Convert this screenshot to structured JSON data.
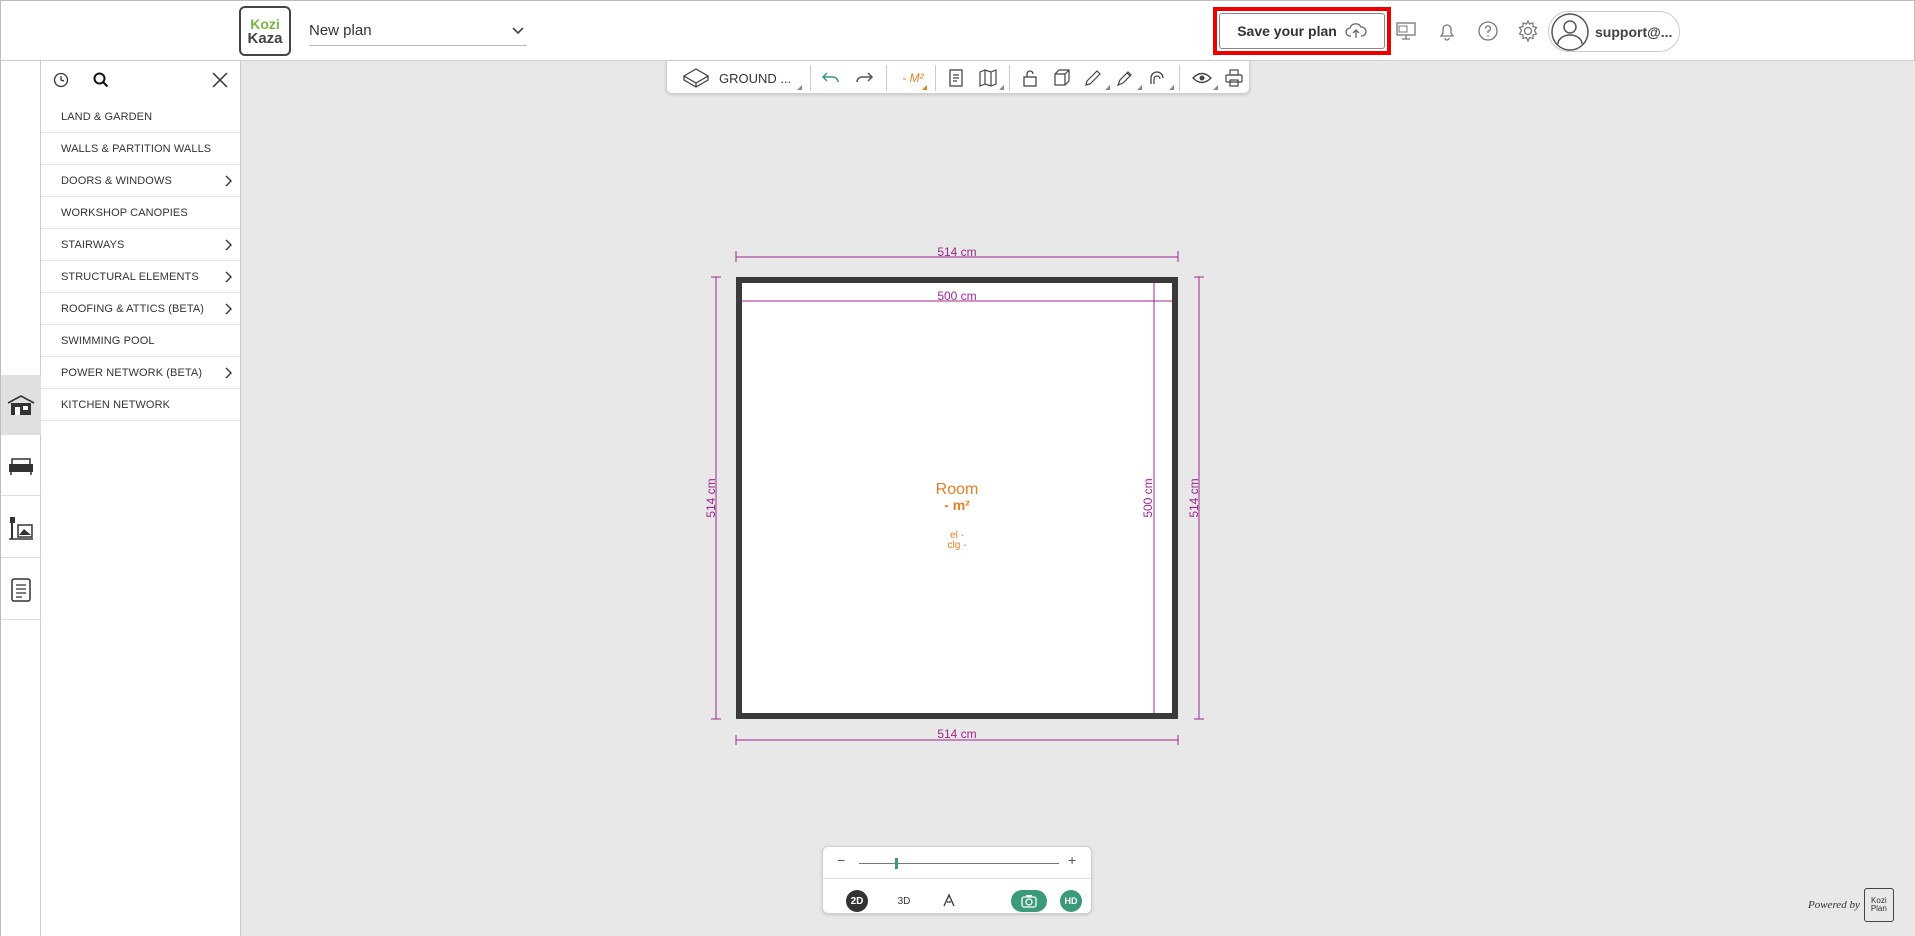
{
  "logo": {
    "line1": "Kozi",
    "line2": "Kaza"
  },
  "plan": {
    "name": "New plan"
  },
  "save": {
    "label": "Save your plan"
  },
  "user": {
    "name": "support@..."
  },
  "categories": [
    {
      "label": "LAND & GARDEN",
      "has_submenu": false
    },
    {
      "label": "WALLS & PARTITION WALLS",
      "has_submenu": false
    },
    {
      "label": "DOORS & WINDOWS",
      "has_submenu": true
    },
    {
      "label": "WORKSHOP CANOPIES",
      "has_submenu": false
    },
    {
      "label": "STAIRWAYS",
      "has_submenu": true
    },
    {
      "label": "STRUCTURAL ELEMENTS",
      "has_submenu": true
    },
    {
      "label": "ROOFING & ATTICS (BETA)",
      "has_submenu": true
    },
    {
      "label": "SWIMMING POOL",
      "has_submenu": false
    },
    {
      "label": "POWER NETWORK (BETA)",
      "has_submenu": true
    },
    {
      "label": "KITCHEN NETWORK",
      "has_submenu": false
    }
  ],
  "toolbar": {
    "level": "GROUND ...",
    "area_unit": "- M²"
  },
  "plan_drawing": {
    "top_outer": "514 cm",
    "top_inner": "500 cm",
    "left_outer": "514 cm",
    "right_inner": "500 cm",
    "right_outer": "514 cm",
    "bottom_outer": "514 cm",
    "room_name": "Room",
    "room_area": "- m²",
    "room_el": "el -",
    "room_clg": "clg -"
  },
  "view": {
    "minus": "−",
    "plus": "+",
    "mode_2d": "2D",
    "mode_3d": "3D",
    "hd": "HD",
    "zoom_level": 0.18
  },
  "powered": {
    "text": "Powered by",
    "brand": "Kozi Plan"
  },
  "colors": {
    "dimension": "#a0268f",
    "room_text": "#e67e22",
    "accent_green": "#3a9a7a",
    "highlight": "#ee0000"
  }
}
